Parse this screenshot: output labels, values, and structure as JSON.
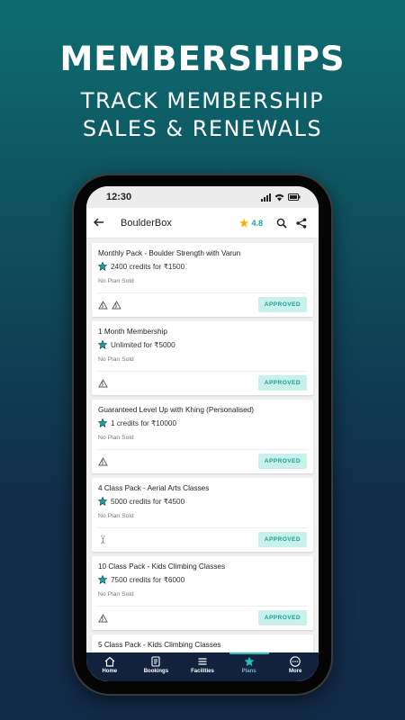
{
  "hero": {
    "title": "MEMBERSHIPS",
    "subtitle_line1": "TRACK MEMBERSHIP",
    "subtitle_line2": "SALES & RENEWALS"
  },
  "status_bar": {
    "time": "12:30"
  },
  "app_bar": {
    "title": "BoulderBox",
    "rating": "4.8",
    "icons": [
      "back-arrow-icon",
      "star-icon",
      "search-icon",
      "share-icon"
    ]
  },
  "plans": [
    {
      "title": "Monthly Pack - Boulder Strength with Varun",
      "credit_text": "2400 credits for ₹1500",
      "sold_text": "No Plan Sold",
      "status": "APPROVED",
      "activity_icons": [
        "climbing-icon",
        "climbing-icon"
      ]
    },
    {
      "title": "1 Month Membership",
      "credit_text": "Unlimited for ₹5000",
      "sold_text": "No Plan Sold",
      "status": "APPROVED",
      "activity_icons": [
        "climbing-icon"
      ]
    },
    {
      "title": "Guaranteed Level Up with Khing (Personalised)",
      "credit_text": "1 credits for ₹10000",
      "sold_text": "No Plan Sold",
      "status": "APPROVED",
      "activity_icons": [
        "climbing-icon"
      ]
    },
    {
      "title": "4 Class Pack - Aerial Arts Classes",
      "credit_text": "5000 credits for ₹4500",
      "sold_text": "No Plan Sold",
      "status": "APPROVED",
      "activity_icons": [
        "aerial-icon"
      ]
    },
    {
      "title": "10 Class Pack - Kids Climbing Classes",
      "credit_text": "7500 credits for ₹6000",
      "sold_text": "No Plan Sold",
      "status": "APPROVED",
      "activity_icons": [
        "climbing-icon"
      ]
    },
    {
      "title": "5 Class Pack - Kids Climbing Classes",
      "credit_text": "",
      "sold_text": "",
      "status": "",
      "activity_icons": []
    }
  ],
  "bottom_nav": {
    "items": [
      {
        "label": "Home",
        "icon": "home-icon"
      },
      {
        "label": "Bookings",
        "icon": "bookings-icon"
      },
      {
        "label": "Facilities",
        "icon": "menu-icon"
      },
      {
        "label": "Plans",
        "icon": "star-icon"
      },
      {
        "label": "More",
        "icon": "more-icon"
      }
    ],
    "active": "Plans"
  },
  "colors": {
    "accent": "#1ec7b8",
    "approved_bg": "#c9f1ec",
    "approved_text": "#1a9e92",
    "nav_bg": "#11223f",
    "rating_star": "#f5b301"
  }
}
